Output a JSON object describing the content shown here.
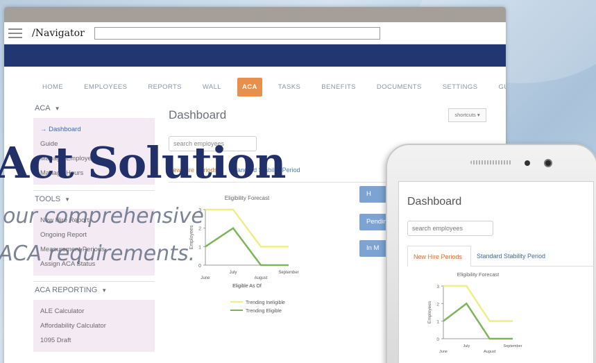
{
  "app": {
    "logo": "/Navigator"
  },
  "nav": {
    "tabs": [
      "HOME",
      "EMPLOYEES",
      "REPORTS",
      "WALL",
      "ACA",
      "TASKS",
      "BENEFITS",
      "DOCUMENTS",
      "SETTINGS",
      "GUIDE"
    ],
    "active": "ACA"
  },
  "sidebar": {
    "sections": [
      {
        "title": "ACA",
        "items": [
          "Dashboard",
          "Guide",
          "Manage Employees",
          "Manage Hours"
        ]
      },
      {
        "title": "TOOLS",
        "items": [
          "New Hire Report",
          "Ongoing Report",
          "Measurement Periods",
          "Assign ACA Status"
        ]
      },
      {
        "title": "ACA REPORTING",
        "items": [
          "ALE Calculator",
          "Affordability Calculator",
          "1095 Draft"
        ]
      }
    ]
  },
  "main": {
    "title": "Dashboard",
    "shortcuts_label": "shortcuts ▾",
    "search_placeholder": "search employees",
    "period_tabs": [
      "New Hire Periods",
      "Standard Stability Period"
    ],
    "side_buttons": [
      "H",
      "Pendin",
      "In M"
    ]
  },
  "overlay": {
    "title": "Act Solution",
    "line1": "our comprehensive",
    "line2": "ACA requirements."
  },
  "phone": {
    "title": "Dashboard",
    "search_placeholder": "search employees",
    "period_tabs": [
      "New Hire Periods",
      "Standard Stability Period"
    ]
  },
  "chart_data": [
    {
      "type": "line",
      "title": "Eligibility Forecast",
      "xlabel": "Eligible As Of",
      "ylabel": "Employees",
      "categories": [
        "June",
        "July",
        "August",
        "September"
      ],
      "series": [
        {
          "name": "Trending Ineligible",
          "values": [
            3,
            3,
            1,
            1
          ],
          "color": "#eeee88"
        },
        {
          "name": "Trending Eligible",
          "values": [
            1,
            2,
            0,
            0
          ],
          "color": "#7fb35a"
        }
      ],
      "ylim": [
        0,
        3
      ],
      "yticks": [
        "0",
        "1",
        "2",
        "3"
      ]
    },
    {
      "type": "line",
      "title": "Eligibility Forecast",
      "ylabel": "Employees",
      "categories": [
        "June",
        "July",
        "August",
        "September"
      ],
      "series": [
        {
          "values": [
            3,
            3,
            1,
            1
          ],
          "color": "#eeee88"
        },
        {
          "values": [
            1,
            2,
            0,
            0
          ],
          "color": "#7fb35a"
        }
      ],
      "ylim": [
        0,
        3
      ],
      "yticks": [
        "0",
        "1",
        "2",
        "3"
      ]
    }
  ]
}
